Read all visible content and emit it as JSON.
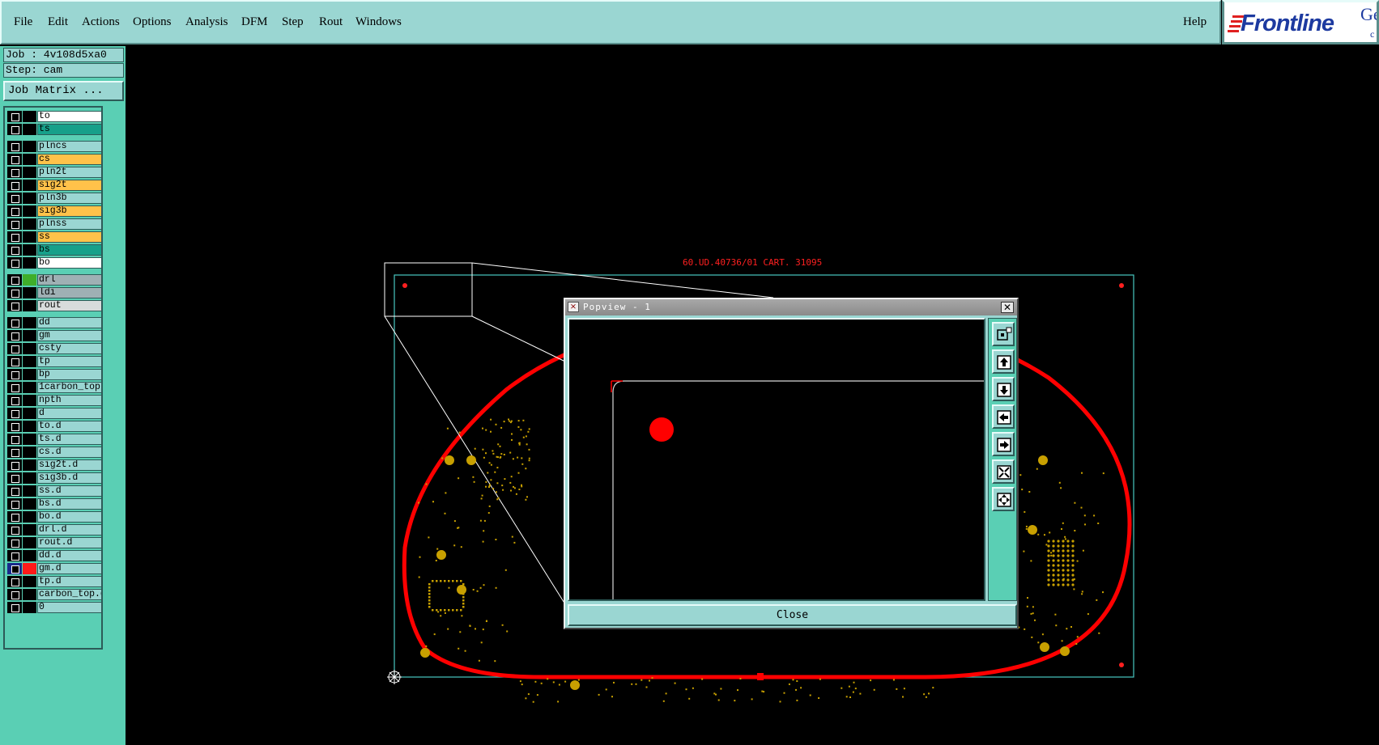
{
  "menubar": {
    "items": [
      "File",
      "Edit",
      "Actions",
      "Options",
      "Analysis",
      "DFM",
      "Step",
      "Rout",
      "Windows"
    ],
    "help": "Help"
  },
  "logo": {
    "word": "Frontline",
    "tail": "Ge",
    "tail2": "c"
  },
  "job": {
    "job_line": "Job : 4v108d5xa0",
    "step_line": "Step: cam",
    "matrix_label": "Job Matrix ..."
  },
  "layers": [
    {
      "name": "to",
      "style": "white",
      "swatch": "#000000"
    },
    {
      "name": "ts",
      "style": "teal",
      "swatch": "#000000"
    },
    {
      "name": "plncs",
      "style": "plain",
      "swatch": "#000000"
    },
    {
      "name": "cs",
      "style": "orange",
      "swatch": "#000000"
    },
    {
      "name": "pln2t",
      "style": "plain",
      "swatch": "#000000"
    },
    {
      "name": "sig2t",
      "style": "orange",
      "swatch": "#000000"
    },
    {
      "name": "pln3b",
      "style": "plain",
      "swatch": "#000000"
    },
    {
      "name": "sig3b",
      "style": "orange",
      "swatch": "#000000"
    },
    {
      "name": "plnss",
      "style": "plain",
      "swatch": "#000000"
    },
    {
      "name": "ss",
      "style": "orange",
      "swatch": "#000000"
    },
    {
      "name": "bs",
      "style": "teal",
      "swatch": "#000000"
    },
    {
      "name": "bo",
      "style": "white",
      "swatch": "#000000"
    },
    {
      "name": "drl",
      "style": "gray",
      "swatch": "#3fae2a"
    },
    {
      "name": "ldi",
      "style": "gray",
      "swatch": "#000000"
    },
    {
      "name": "rout",
      "style": "ltgray",
      "swatch": "#000000"
    },
    {
      "name": "dd",
      "style": "plain",
      "swatch": "#000000"
    },
    {
      "name": "gm",
      "style": "plain",
      "swatch": "#000000"
    },
    {
      "name": "csty",
      "style": "plain",
      "swatch": "#000000"
    },
    {
      "name": "tp",
      "style": "plain",
      "swatch": "#000000"
    },
    {
      "name": "bp",
      "style": "plain",
      "swatch": "#000000"
    },
    {
      "name": "1carbon_top",
      "style": "plain",
      "swatch": "#000000"
    },
    {
      "name": "npth",
      "style": "plain",
      "swatch": "#000000"
    },
    {
      "name": "d",
      "style": "plain",
      "swatch": "#000000"
    },
    {
      "name": "to.d",
      "style": "plain",
      "swatch": "#000000"
    },
    {
      "name": "ts.d",
      "style": "plain",
      "swatch": "#000000"
    },
    {
      "name": "cs.d",
      "style": "plain",
      "swatch": "#000000"
    },
    {
      "name": "sig2t.d",
      "style": "plain",
      "swatch": "#000000"
    },
    {
      "name": "sig3b.d",
      "style": "plain",
      "swatch": "#000000"
    },
    {
      "name": "ss.d",
      "style": "plain",
      "swatch": "#000000"
    },
    {
      "name": "bs.d",
      "style": "plain",
      "swatch": "#000000"
    },
    {
      "name": "bo.d",
      "style": "plain",
      "swatch": "#000000"
    },
    {
      "name": "drl.d",
      "style": "plain",
      "swatch": "#000000"
    },
    {
      "name": "rout.d",
      "style": "plain",
      "swatch": "#000000"
    },
    {
      "name": "dd.d",
      "style": "plain",
      "swatch": "#000000"
    },
    {
      "name": "gm.d",
      "style": "plain",
      "swatch": "#ff1a1a",
      "active": true
    },
    {
      "name": "tp.d",
      "style": "plain",
      "swatch": "#000000"
    },
    {
      "name": "carbon_top.d",
      "style": "plain",
      "swatch": "#000000"
    },
    {
      "name": "0",
      "style": "plain",
      "swatch": "#000000"
    }
  ],
  "board": {
    "title": "60.UD.40736/01 CART. 31095"
  },
  "popview": {
    "title": "Popview - 1",
    "close_label": "Close",
    "tools": [
      "zoom-home-icon",
      "pan-up-icon",
      "pan-down-icon",
      "pan-left-icon",
      "pan-right-icon",
      "zoom-fit-icon",
      "zoom-center-icon"
    ]
  },
  "colors": {
    "panel": "#9ad6d2",
    "panel_dark": "#5acfb4",
    "board_outline": "#ff0000",
    "pads": "#c8a000",
    "frame": "#48c8c0"
  }
}
